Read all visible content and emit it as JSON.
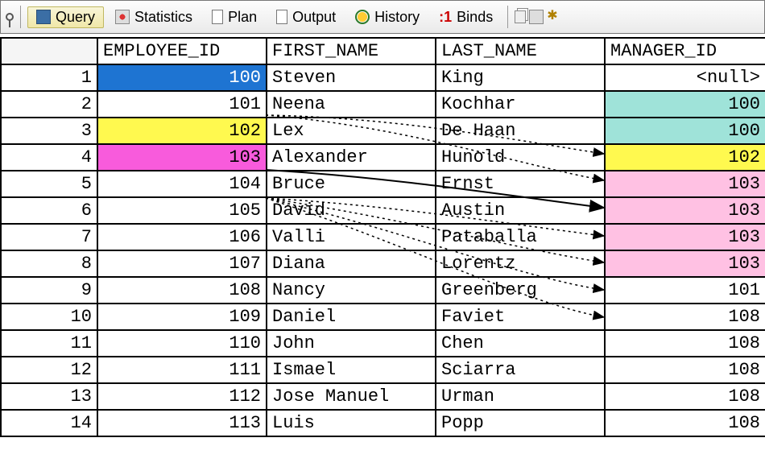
{
  "toolbar": {
    "query": "Query",
    "statistics": "Statistics",
    "plan": "Plan",
    "output": "Output",
    "history": "History",
    "binds_prefix": ":1",
    "binds": "Binds"
  },
  "columns": {
    "rownum": "",
    "employee_id": "EMPLOYEE_ID",
    "first_name": "FIRST_NAME",
    "last_name": "LAST_NAME",
    "manager_id": "MANAGER_ID"
  },
  "rows": [
    {
      "n": "1",
      "emp": "100",
      "first": "Steven",
      "last": "King",
      "mgr": "<null>",
      "emp_cls": "hl-blue",
      "mgr_cls": ""
    },
    {
      "n": "2",
      "emp": "101",
      "first": "Neena",
      "last": "Kochhar",
      "mgr": "100",
      "emp_cls": "",
      "mgr_cls": "hl-teal"
    },
    {
      "n": "3",
      "emp": "102",
      "first": "Lex",
      "last": "De Haan",
      "mgr": "100",
      "emp_cls": "hl-yellow",
      "mgr_cls": "hl-teal"
    },
    {
      "n": "4",
      "emp": "103",
      "first": "Alexander",
      "last": "Hunold",
      "mgr": "102",
      "emp_cls": "hl-magenta",
      "mgr_cls": "hl-ylw2"
    },
    {
      "n": "5",
      "emp": "104",
      "first": "Bruce",
      "last": "Ernst",
      "mgr": "103",
      "emp_cls": "",
      "mgr_cls": "hl-pink"
    },
    {
      "n": "6",
      "emp": "105",
      "first": "David",
      "last": "Austin",
      "mgr": "103",
      "emp_cls": "",
      "mgr_cls": "hl-pink"
    },
    {
      "n": "7",
      "emp": "106",
      "first": "Valli",
      "last": "Pataballa",
      "mgr": "103",
      "emp_cls": "",
      "mgr_cls": "hl-pink"
    },
    {
      "n": "8",
      "emp": "107",
      "first": "Diana",
      "last": "Lorentz",
      "mgr": "103",
      "emp_cls": "",
      "mgr_cls": "hl-pink"
    },
    {
      "n": "9",
      "emp": "108",
      "first": "Nancy",
      "last": "Greenberg",
      "mgr": "101",
      "emp_cls": "",
      "mgr_cls": ""
    },
    {
      "n": "10",
      "emp": "109",
      "first": "Daniel",
      "last": "Faviet",
      "mgr": "108",
      "emp_cls": "",
      "mgr_cls": ""
    },
    {
      "n": "11",
      "emp": "110",
      "first": "John",
      "last": "Chen",
      "mgr": "108",
      "emp_cls": "",
      "mgr_cls": ""
    },
    {
      "n": "12",
      "emp": "111",
      "first": "Ismael",
      "last": "Sciarra",
      "mgr": "108",
      "emp_cls": "",
      "mgr_cls": ""
    },
    {
      "n": "13",
      "emp": "112",
      "first": "Jose Manuel",
      "last": "Urman",
      "mgr": "108",
      "emp_cls": "",
      "mgr_cls": ""
    },
    {
      "n": "14",
      "emp": "113",
      "first": "Luis",
      "last": "Popp",
      "mgr": "108",
      "emp_cls": "",
      "mgr_cls": ""
    }
  ]
}
